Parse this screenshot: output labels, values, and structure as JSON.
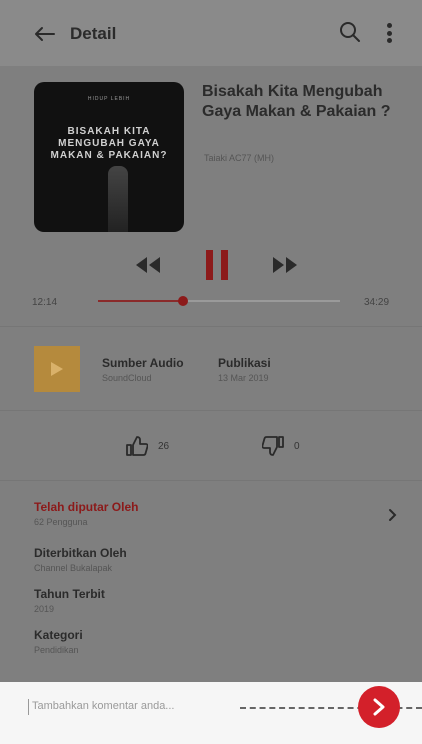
{
  "header": {
    "title": "Detail",
    "icons": {
      "back": "arrow-left-icon",
      "search": "search-icon",
      "more": "more-vert-icon"
    }
  },
  "episode": {
    "cover": {
      "small_text": "HIDUP LEBIH",
      "title_lines": [
        "BISAKAH KITA",
        "MENGUBAH GAYA",
        "MAKAN & PAKAIAN?"
      ]
    },
    "title": "Bisakah Kita Mengubah Gaya Makan & Pakaian ?",
    "author": "Taiaki AC77 (MH)"
  },
  "player": {
    "current_time": "12:14",
    "total_time": "34:29",
    "progress": 0.35
  },
  "source": {
    "label": "Sumber Audio",
    "value": "SoundCloud",
    "pub_label": "Publikasi",
    "pub_value": "13 Mar 2019"
  },
  "votes": {
    "likes": "26",
    "dislikes": "0"
  },
  "info": {
    "played_by_label": "Telah diputar Oleh",
    "played_by_value": "62 Pengguna",
    "publisher_label": "Diterbitkan Oleh",
    "publisher_value": "Channel Bukalapak",
    "year_label": "Tahun Terbit",
    "year_value": "2019",
    "category_label": "Kategori",
    "category_value": "Pendidikan"
  },
  "comment": {
    "placeholder": "Tambahkan komentar anda..."
  },
  "colors": {
    "accent": "#d3202a",
    "dark_red": "#8c1a1a",
    "audio_tile": "#b58a3d"
  }
}
